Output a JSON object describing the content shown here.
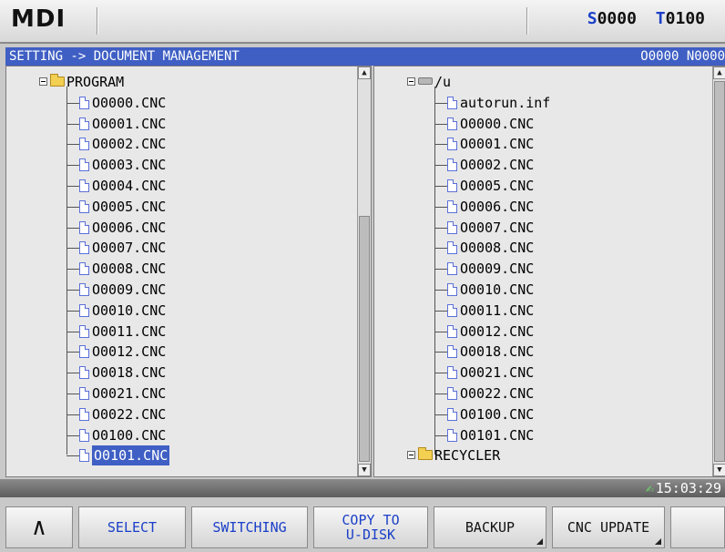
{
  "header": {
    "mode": "MDI",
    "spindle_prefix": "S",
    "spindle_value": "0000",
    "tool_prefix": "T",
    "tool_value": "0100"
  },
  "titlebar": {
    "path": "SETTING -> DOCUMENT MANAGEMENT",
    "program_info": "O0000 N0000"
  },
  "left_tree": {
    "root": "PROGRAM",
    "files": [
      "O0000.CNC",
      "O0001.CNC",
      "O0002.CNC",
      "O0003.CNC",
      "O0004.CNC",
      "O0005.CNC",
      "O0006.CNC",
      "O0007.CNC",
      "O0008.CNC",
      "O0009.CNC",
      "O0010.CNC",
      "O0011.CNC",
      "O0012.CNC",
      "O0018.CNC",
      "O0021.CNC",
      "O0022.CNC",
      "O0100.CNC",
      "O0101.CNC"
    ],
    "selected": "O0101.CNC"
  },
  "right_tree": {
    "root": "/u",
    "files": [
      "autorun.inf",
      "O0000.CNC",
      "O0001.CNC",
      "O0002.CNC",
      "O0005.CNC",
      "O0006.CNC",
      "O0007.CNC",
      "O0008.CNC",
      "O0009.CNC",
      "O0010.CNC",
      "O0011.CNC",
      "O0012.CNC",
      "O0018.CNC",
      "O0021.CNC",
      "O0022.CNC",
      "O0100.CNC",
      "O0101.CNC"
    ],
    "folder": "RECYCLER"
  },
  "status": {
    "time": "15:03:29"
  },
  "softkeys": {
    "up": "^",
    "select": "SELECT",
    "switching": "SWITCHING",
    "copy": "COPY TO\nU-DISK",
    "backup": "BACKUP",
    "update": "CNC UPDATE"
  }
}
